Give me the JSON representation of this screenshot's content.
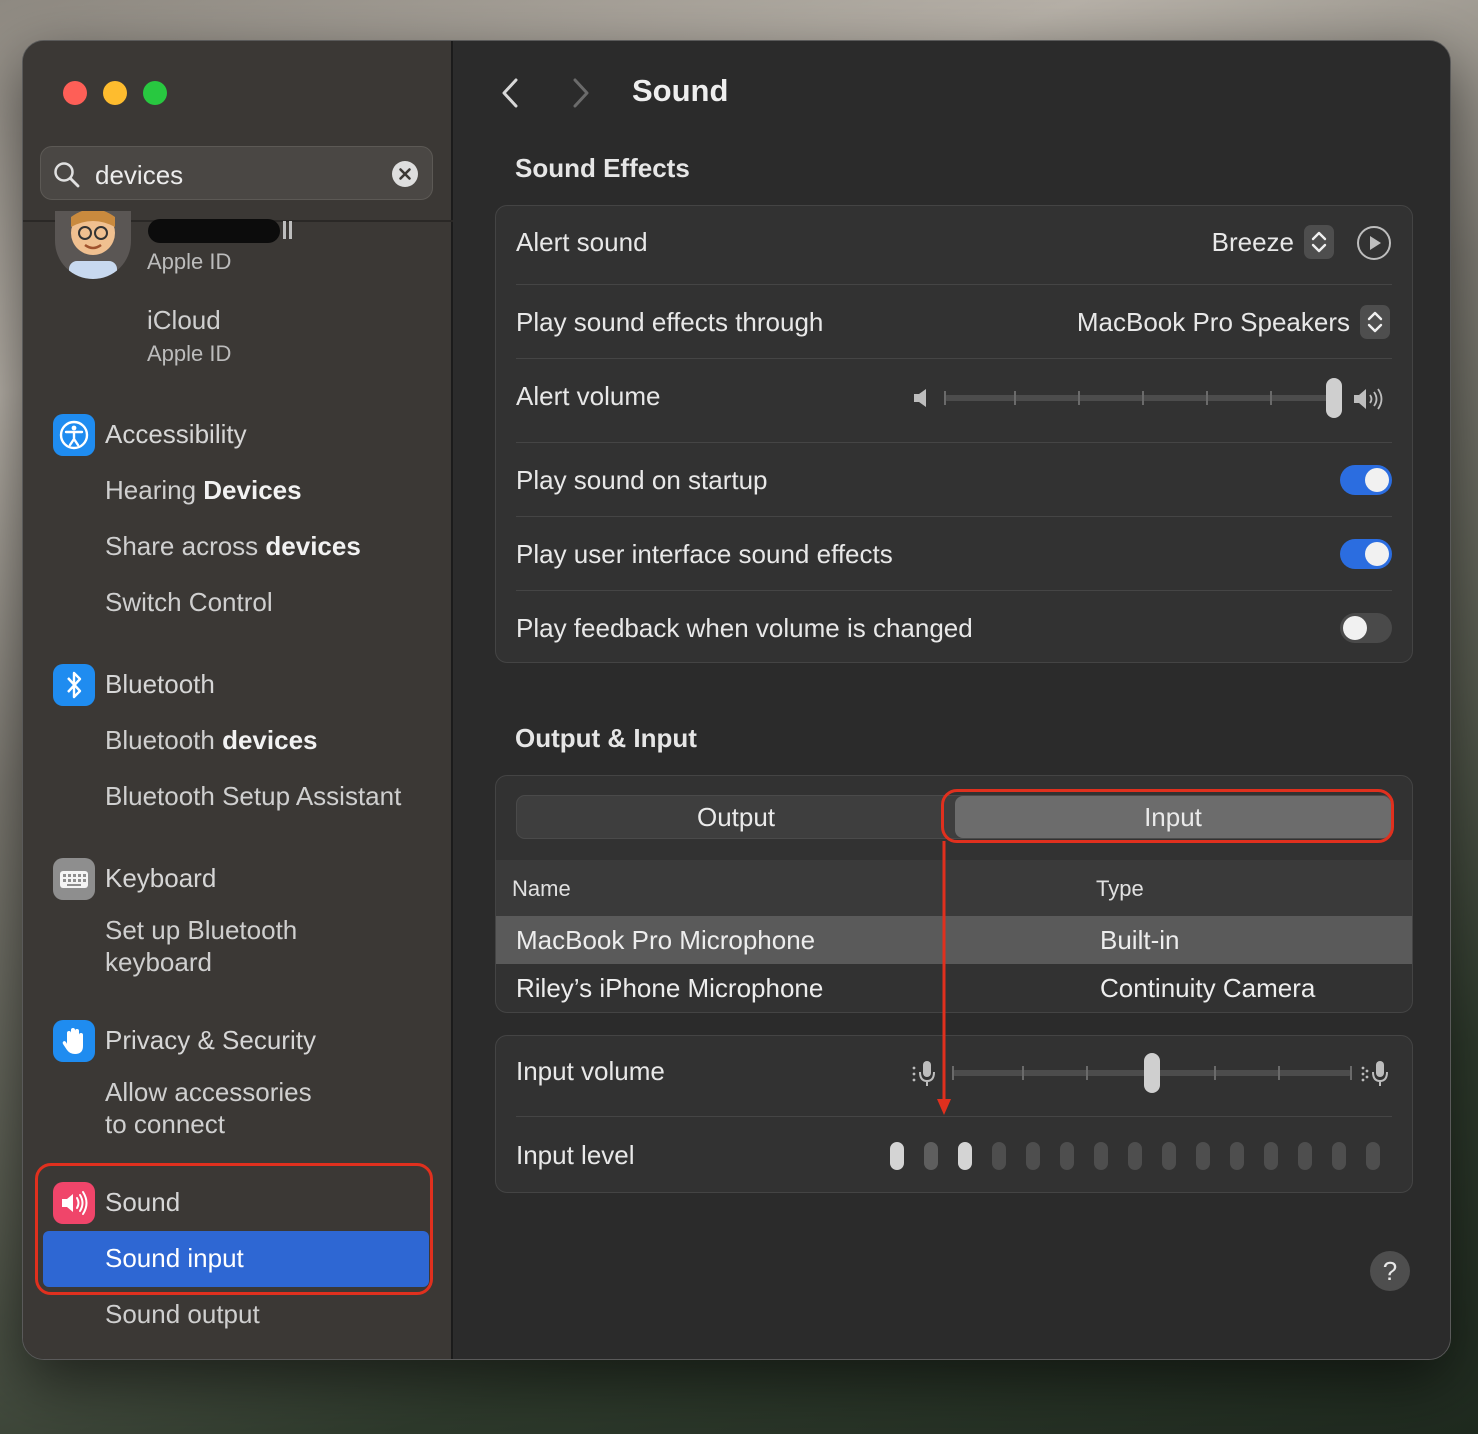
{
  "window": {
    "title": "Sound"
  },
  "search": {
    "value": "devices"
  },
  "sidebar": {
    "account": {
      "subtitle": "Apple ID"
    },
    "icloud": {
      "title": "iCloud",
      "subtitle": "Apple ID"
    },
    "accessibility": {
      "label": "Accessibility",
      "hearing": {
        "pre": "Hearing ",
        "match": "Devices"
      },
      "share": {
        "pre": "Share across ",
        "match": "devices"
      },
      "switch": "Switch Control"
    },
    "bluetooth": {
      "label": "Bluetooth",
      "devices": {
        "pre": "Bluetooth ",
        "match": "devices"
      },
      "assistant": "Bluetooth Setup Assistant"
    },
    "keyboard": {
      "label": "Keyboard",
      "setup_line1": "Set up Bluetooth",
      "setup_line2": "keyboard"
    },
    "privacy": {
      "label": "Privacy & Security",
      "allow_line1": "Allow accessories",
      "allow_line2": "to connect"
    },
    "sound": {
      "label": "Sound",
      "input": "Sound input",
      "output": "Sound output"
    }
  },
  "sound_effects": {
    "heading": "Sound Effects",
    "alert_sound": {
      "label": "Alert sound",
      "value": "Breeze"
    },
    "effects_through": {
      "label": "Play sound effects through",
      "value": "MacBook Pro Speakers"
    },
    "alert_volume": {
      "label": "Alert volume",
      "level": 1.0
    },
    "startup": {
      "label": "Play sound on startup",
      "on": true
    },
    "ui_effects": {
      "label": "Play user interface sound effects",
      "on": true
    },
    "feedback": {
      "label": "Play feedback when volume is changed",
      "on": false
    }
  },
  "output_input": {
    "heading": "Output & Input",
    "tabs": [
      "Output",
      "Input"
    ],
    "selected_tab": "Input",
    "columns": [
      "Name",
      "Type"
    ],
    "devices": [
      {
        "name": "MacBook Pro Microphone",
        "type": "Built-in",
        "selected": true
      },
      {
        "name": "Riley’s iPhone Microphone",
        "type": "Continuity Camera",
        "selected": false
      }
    ],
    "input_volume": {
      "label": "Input volume",
      "level": 0.5
    },
    "input_level": {
      "label": "Input level",
      "lit_segments": 3,
      "total_segments": 15
    }
  },
  "colors": {
    "accent": "#2e67d3",
    "toggle_on": "#2b6de0",
    "annotation": "#e0301e"
  },
  "icons": [
    "search-icon",
    "clear-icon",
    "accessibility-icon",
    "bluetooth-icon",
    "keyboard-icon",
    "hand-icon",
    "speaker-icon",
    "play-icon",
    "mic-icon",
    "help-icon"
  ]
}
